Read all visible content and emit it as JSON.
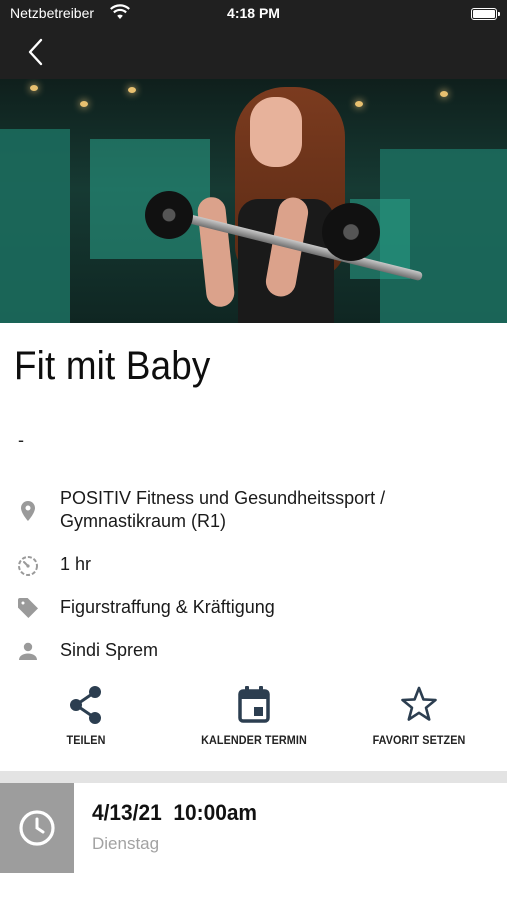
{
  "status_bar": {
    "carrier": "Netzbetreiber",
    "time": "4:18 PM",
    "icons": [
      "wifi-icon",
      "battery-icon"
    ]
  },
  "nav": {
    "back_icon": "chevron-left-icon"
  },
  "event": {
    "title": "Fit mit Baby",
    "subtitle": "-",
    "location": "POSITIV Fitness und Gesundheitssport /",
    "location_line2": "Gymnastikraum (R1)",
    "duration": "1 hr",
    "category": "Figurstraffung & Kräftigung",
    "trainer": "Sindi Sprem"
  },
  "actions": {
    "share_label": "TEILEN",
    "calendar_label": "KALENDER TERMIN",
    "favorite_label": "FAVORIT SETZEN"
  },
  "schedule": {
    "date": "4/13/21",
    "time": "10:00am",
    "weekday": "Dienstag"
  },
  "colors": {
    "nav_background": "#202020",
    "icon_gray": "#9a9a9a",
    "action_icon": "#2c3e50",
    "clock_box": "#9d9d9d",
    "divider": "#e3e3e3"
  }
}
